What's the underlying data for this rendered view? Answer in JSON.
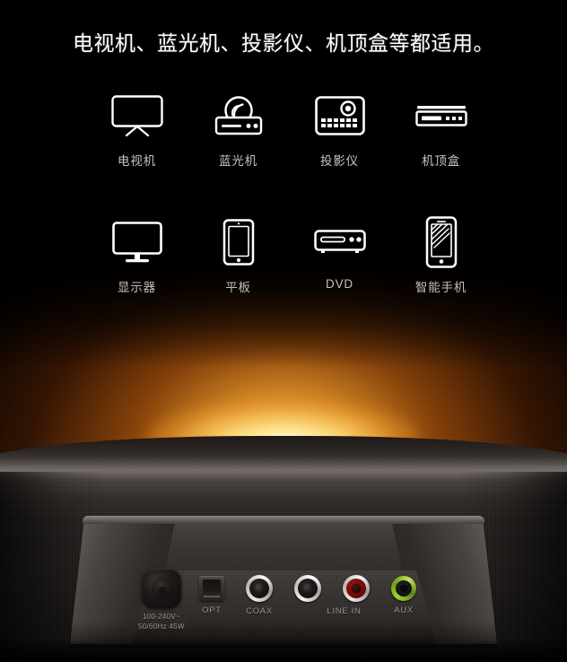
{
  "headline": "电视机、蓝光机、投影仪、机顶盒等都适用。",
  "devices": {
    "row1": [
      {
        "label": "电视机",
        "icon": "tv-icon"
      },
      {
        "label": "蓝光机",
        "icon": "bluray-player-icon"
      },
      {
        "label": "投影仪",
        "icon": "projector-icon"
      },
      {
        "label": "机顶盒",
        "icon": "set-top-box-icon"
      }
    ],
    "row2": [
      {
        "label": "显示器",
        "icon": "monitor-icon"
      },
      {
        "label": "平板",
        "icon": "tablet-icon"
      },
      {
        "label": "DVD",
        "icon": "dvd-player-icon"
      },
      {
        "label": "智能手机",
        "icon": "smartphone-icon"
      }
    ]
  },
  "soundbar": {
    "ports": [
      {
        "name": "power-socket",
        "label": "100-240V~\n50/60Hz  45W",
        "type": "iec-power"
      },
      {
        "name": "optical-port",
        "label": "OPT",
        "type": "toslink"
      },
      {
        "name": "coax-port",
        "label": "COAX",
        "type": "rca-black"
      },
      {
        "name": "line-in-white",
        "label": "",
        "type": "rca-white"
      },
      {
        "name": "line-in-red",
        "label": "LINE IN",
        "type": "rca-red"
      },
      {
        "name": "aux-port",
        "label": "AUX",
        "type": "aux-green"
      }
    ]
  },
  "colors": {
    "glow_core": "#fff4ba",
    "glow_mid": "#f8a02c",
    "glow_outer": "#963c08",
    "aux_green": "#8cc22b",
    "rca_red": "#9d1410",
    "label_text": "#c9c5c2",
    "port_text": "#9b9591",
    "headline_text": "#ffffff"
  }
}
